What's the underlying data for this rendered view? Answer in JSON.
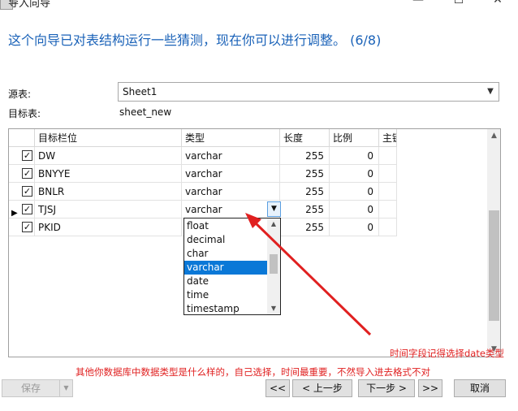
{
  "window": {
    "title": "导入向导",
    "min": "—",
    "max": "☐",
    "close": "✕"
  },
  "heading": "这个向导已对表结构运行一些猜测，现在你可以进行调整。 (6/8)",
  "source": {
    "label": "源表:",
    "value": "Sheet1"
  },
  "target": {
    "label": "目标表:",
    "value": "sheet_new"
  },
  "grid": {
    "columns": [
      "目标栏位",
      "类型",
      "长度",
      "比例",
      "主键"
    ],
    "rows": [
      {
        "checked": true,
        "field": "DW",
        "type": "varchar",
        "length": "255",
        "scale": "0"
      },
      {
        "checked": true,
        "field": "BNYYE",
        "type": "varchar",
        "length": "255",
        "scale": "0"
      },
      {
        "checked": true,
        "field": "BNLR",
        "type": "varchar",
        "length": "255",
        "scale": "0"
      },
      {
        "checked": true,
        "field": "TJSJ",
        "type": "varchar",
        "length": "255",
        "scale": "0",
        "current": true
      },
      {
        "checked": true,
        "field": "PKID",
        "type": "",
        "length": "255",
        "scale": "0"
      }
    ]
  },
  "type_dropdown": {
    "options": [
      "float",
      "decimal",
      "char",
      "varchar",
      "date",
      "time",
      "timestamp"
    ],
    "selected": "varchar"
  },
  "annotations": {
    "tip_right": "时间字段记得选择date类型",
    "tip_bottom": "其他你数据库中数据类型是什么样的，自己选择，时间最重要，不然导入进去格式不对",
    "color": "#e02020"
  },
  "buttons": {
    "save": "保存",
    "first": "<<",
    "prev": "< 上一步",
    "next": "下一步 >",
    "last": ">>",
    "cancel": "取消"
  }
}
